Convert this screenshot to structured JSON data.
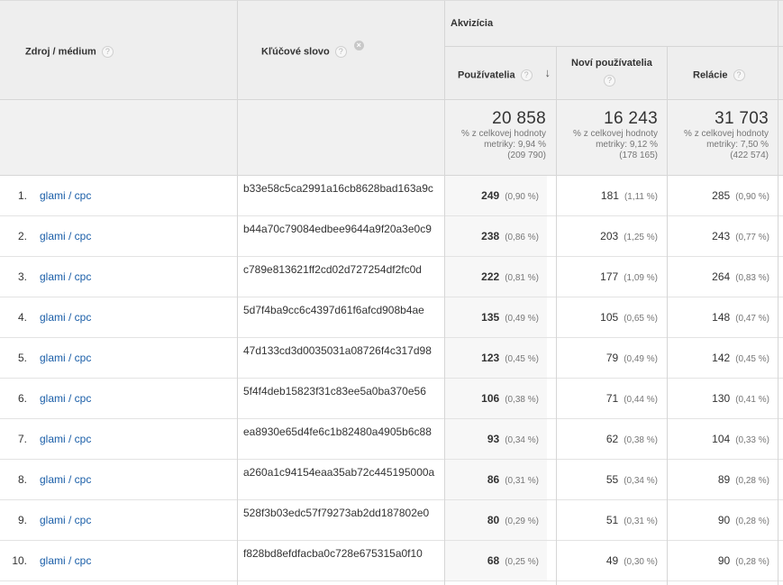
{
  "header": {
    "source_medium": "Zdroj / médium",
    "keyword": "Kľúčové slovo",
    "acquisition": "Akvizícia",
    "users": "Používatelia",
    "new_users": "Noví používatelia",
    "sessions": "Relácie",
    "help_glyph": "?",
    "remove_glyph": "×",
    "sort_glyph": "↓"
  },
  "totals": {
    "users": {
      "value": "20 858",
      "line1": "% z celkovej hodnoty",
      "line2": "metriky: 9,94 %",
      "line3": "(209 790)"
    },
    "new_users": {
      "value": "16 243",
      "line1": "% z celkovej hodnoty",
      "line2": "metriky: 9,12 %",
      "line3": "(178 165)"
    },
    "sessions": {
      "value": "31 703",
      "line1": "% z celkovej hodnoty",
      "line2": "metriky: 7,50 %",
      "line3": "(422 574)"
    }
  },
  "rows": [
    {
      "idx": "1.",
      "source": "glami / cpc",
      "keyword": "b33e58c5ca2991a16cb8628bad163a9c",
      "users": "249",
      "users_pct": "(0,90 %)",
      "new_users": "181",
      "new_users_pct": "(1,11 %)",
      "sessions": "285",
      "sessions_pct": "(0,90 %)"
    },
    {
      "idx": "2.",
      "source": "glami / cpc",
      "keyword": "b44a70c79084edbee9644a9f20a3e0c9",
      "users": "238",
      "users_pct": "(0,86 %)",
      "new_users": "203",
      "new_users_pct": "(1,25 %)",
      "sessions": "243",
      "sessions_pct": "(0,77 %)"
    },
    {
      "idx": "3.",
      "source": "glami / cpc",
      "keyword": "c789e813621ff2cd02d727254df2fc0d",
      "users": "222",
      "users_pct": "(0,81 %)",
      "new_users": "177",
      "new_users_pct": "(1,09 %)",
      "sessions": "264",
      "sessions_pct": "(0,83 %)"
    },
    {
      "idx": "4.",
      "source": "glami / cpc",
      "keyword": "5d7f4ba9cc6c4397d61f6afcd908b4ae",
      "users": "135",
      "users_pct": "(0,49 %)",
      "new_users": "105",
      "new_users_pct": "(0,65 %)",
      "sessions": "148",
      "sessions_pct": "(0,47 %)"
    },
    {
      "idx": "5.",
      "source": "glami / cpc",
      "keyword": "47d133cd3d0035031a08726f4c317d98",
      "users": "123",
      "users_pct": "(0,45 %)",
      "new_users": "79",
      "new_users_pct": "(0,49 %)",
      "sessions": "142",
      "sessions_pct": "(0,45 %)"
    },
    {
      "idx": "6.",
      "source": "glami / cpc",
      "keyword": "5f4f4deb15823f31c83ee5a0ba370e56",
      "users": "106",
      "users_pct": "(0,38 %)",
      "new_users": "71",
      "new_users_pct": "(0,44 %)",
      "sessions": "130",
      "sessions_pct": "(0,41 %)"
    },
    {
      "idx": "7.",
      "source": "glami / cpc",
      "keyword": "ea8930e65d4fe6c1b82480a4905b6c88",
      "users": "93",
      "users_pct": "(0,34 %)",
      "new_users": "62",
      "new_users_pct": "(0,38 %)",
      "sessions": "104",
      "sessions_pct": "(0,33 %)"
    },
    {
      "idx": "8.",
      "source": "glami / cpc",
      "keyword": "a260a1c94154eaa35ab72c445195000a",
      "users": "86",
      "users_pct": "(0,31 %)",
      "new_users": "55",
      "new_users_pct": "(0,34 %)",
      "sessions": "89",
      "sessions_pct": "(0,28 %)"
    },
    {
      "idx": "9.",
      "source": "glami / cpc",
      "keyword": "528f3b03edc57f79273ab2dd187802e0",
      "users": "80",
      "users_pct": "(0,29 %)",
      "new_users": "51",
      "new_users_pct": "(0,31 %)",
      "sessions": "90",
      "sessions_pct": "(0,28 %)"
    },
    {
      "idx": "10.",
      "source": "glami / cpc",
      "keyword": "f828bd8efdfacba0c728e675315a0f10",
      "users": "68",
      "users_pct": "(0,25 %)",
      "new_users": "49",
      "new_users_pct": "(0,30 %)",
      "sessions": "90",
      "sessions_pct": "(0,28 %)"
    }
  ]
}
